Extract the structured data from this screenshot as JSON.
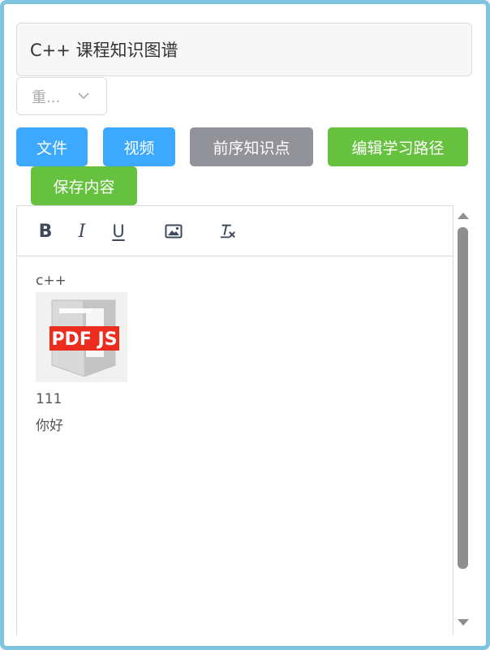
{
  "title_input": {
    "value": "C++ 课程知识图谱"
  },
  "select": {
    "value": "重..."
  },
  "buttons": {
    "file": "文件",
    "video": "视频",
    "prereq": "前序知识点",
    "edit_path": "编辑学习路径",
    "save": "保存内容"
  },
  "toolbar": {
    "bold": "B",
    "italic": "I",
    "underline": "U"
  },
  "content": {
    "line1": "c++",
    "image_label": "PDF JS",
    "line2": "111",
    "line3": "你好"
  },
  "colors": {
    "primary": "#3da8ff",
    "gray": "#919399",
    "success": "#66c13f",
    "frame": "#7ec4df"
  },
  "icons": [
    "chevron-down-icon",
    "image-icon",
    "clear-format-icon",
    "scroll-up-icon",
    "scroll-down-icon"
  ]
}
